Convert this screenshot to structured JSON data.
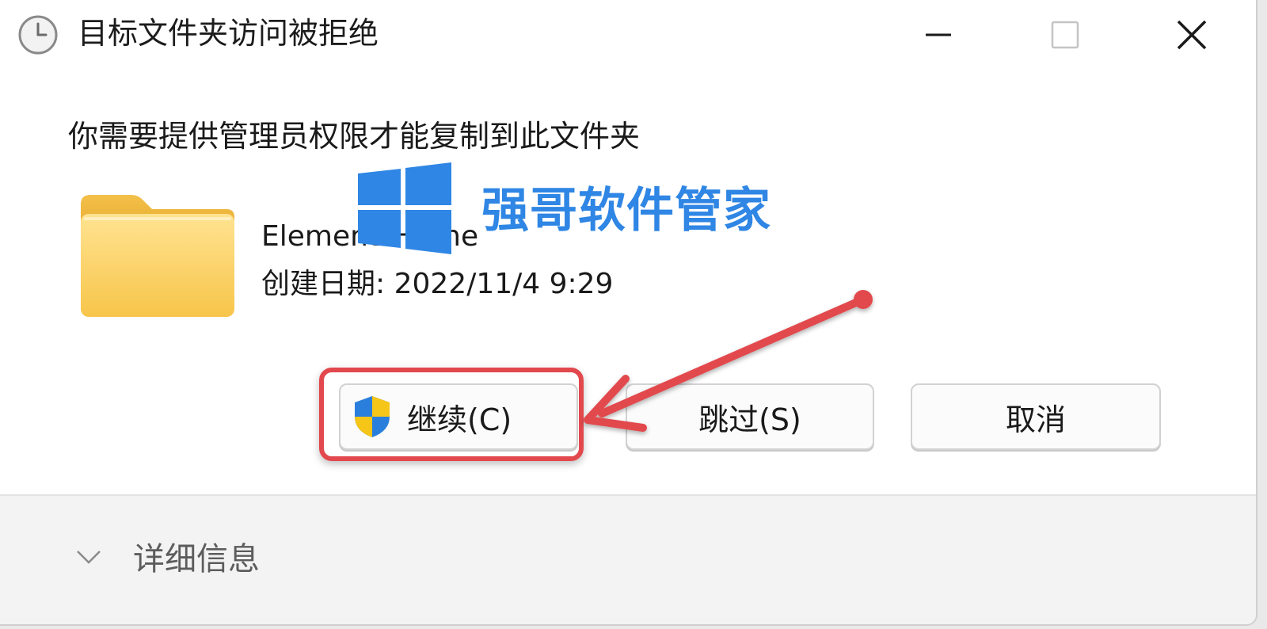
{
  "window": {
    "title": "目标文件夹访问被拒绝",
    "title_icon": "clock-icon",
    "controls": {
      "minimize_icon": "minimize-icon",
      "maximize_icon": "maximize-icon",
      "close_icon": "close-icon"
    }
  },
  "body": {
    "message": "你需要提供管理员权限才能复制到此文件夹",
    "item": {
      "icon": "folder-icon",
      "name": "ElementsHome",
      "created_label": "创建日期: 2022/11/4 9:29"
    }
  },
  "buttons": {
    "continue": {
      "label": "继续(C)",
      "icon": "uac-shield-icon"
    },
    "skip": {
      "label": "跳过(S)"
    },
    "cancel": {
      "label": "取消"
    }
  },
  "footer": {
    "details_label": "详细信息",
    "details_icon": "chevron-down-icon"
  },
  "watermark": {
    "text": "强哥软件管家",
    "logo": "windows-logo-icon",
    "color": "#2f86e4"
  },
  "annotation": {
    "color": "#e2484d",
    "target": "continue-button"
  }
}
